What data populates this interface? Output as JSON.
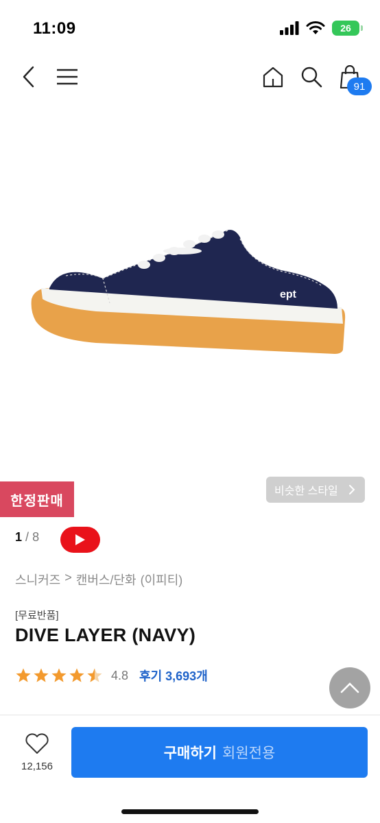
{
  "status_bar": {
    "time": "11:09",
    "battery": "26"
  },
  "nav": {
    "cart_count": "91"
  },
  "image": {
    "brand_label": "ept"
  },
  "badges": {
    "limited": "한정판매",
    "similar_style": "비슷한 스타일"
  },
  "gallery": {
    "current": "1",
    "separator": "/",
    "total": "8"
  },
  "breadcrumb": [
    "스니커즈",
    ">",
    "캔버스/단화",
    "(이피티)"
  ],
  "product": {
    "tag": "[무료반품]",
    "name": "DIVE LAYER (NAVY)",
    "rating": "4.8",
    "stars": 4.5,
    "review_link": "후기 3,693개"
  },
  "peek_text": "0.1",
  "bottom_bar": {
    "like_count": "12,156",
    "buy_label": "구매하기",
    "buy_sublabel": "회원전용"
  },
  "colors": {
    "accent_blue": "#1e7bf0",
    "limited_red": "#d9485f",
    "youtube_red": "#e9121a",
    "star_orange": "#f39a2e",
    "shoe_navy": "#1f2650",
    "sole_gum": "#e8a24a"
  }
}
